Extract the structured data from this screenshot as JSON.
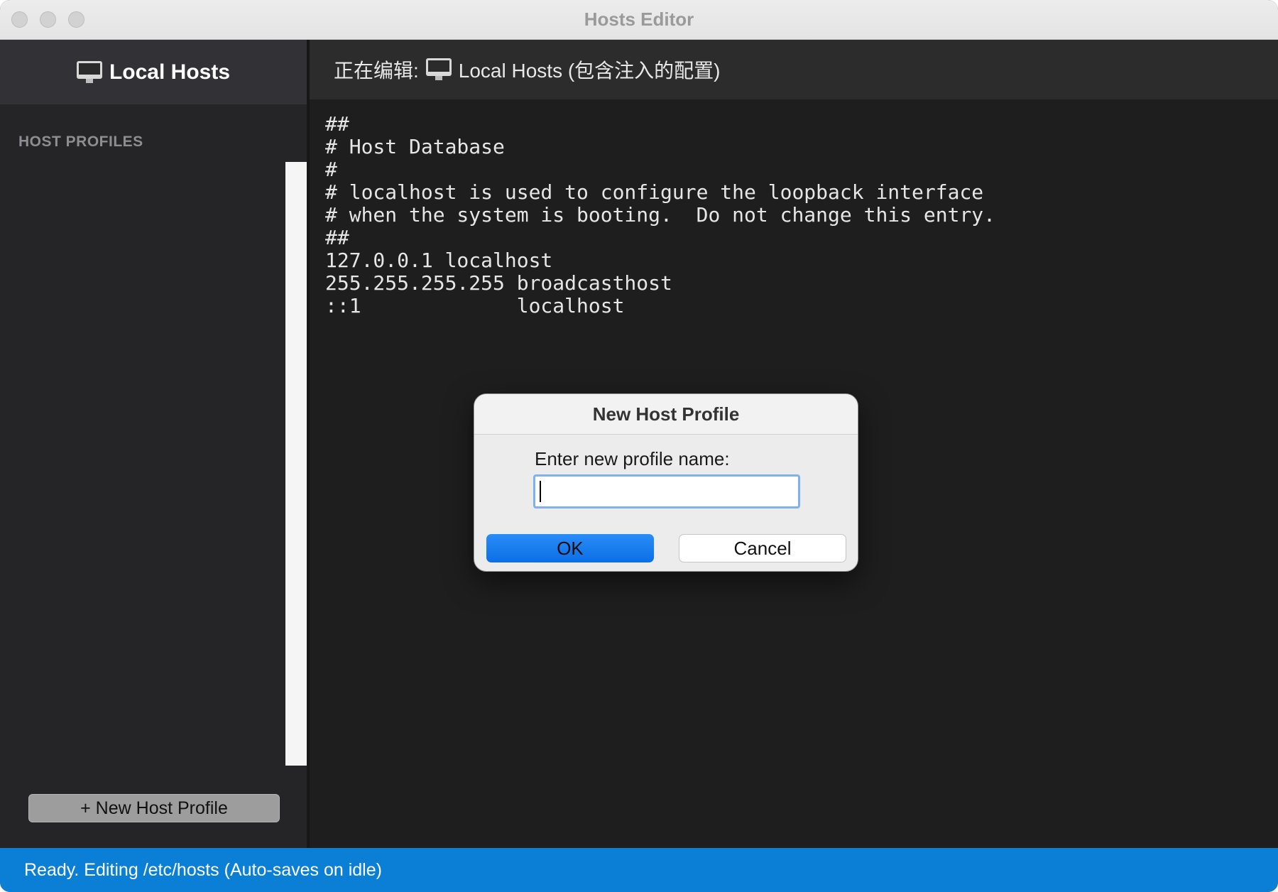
{
  "window": {
    "title": "Hosts Editor"
  },
  "sidebar": {
    "header_title": "Local Hosts",
    "header_icon": "monitor-icon",
    "section_label": "HOST PROFILES",
    "profiles": [],
    "new_profile_button": "+ New Host Profile"
  },
  "editor": {
    "header_label": "正在编辑:",
    "header_icon": "monitor-icon",
    "header_profile": "Local Hosts (包含注入的配置)",
    "lines": [
      "##",
      "# Host Database",
      "#",
      "# localhost is used to configure the loopback interface",
      "# when the system is booting.  Do not change this entry.",
      "##",
      "127.0.0.1 localhost",
      "255.255.255.255 broadcasthost",
      "::1             localhost"
    ]
  },
  "dialog": {
    "title": "New Host Profile",
    "prompt": "Enter new profile name:",
    "input_value": "",
    "ok_label": "OK",
    "cancel_label": "Cancel"
  },
  "statusbar": {
    "text": "Ready. Editing /etc/hosts (Auto-saves on idle)"
  },
  "colors": {
    "status_bar": "#0b7fd6",
    "ok_button": "#0b6fe6",
    "input_focus_ring": "#7eb1ee"
  }
}
